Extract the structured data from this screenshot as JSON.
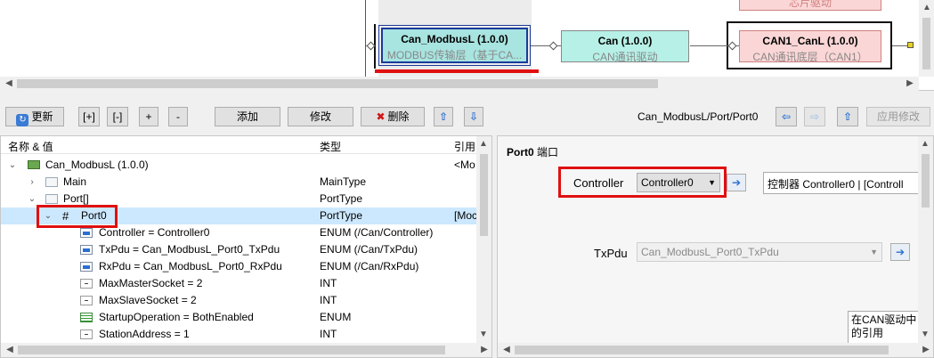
{
  "diagram": {
    "top_node_sub": "芯片驱动",
    "nodes": [
      {
        "title": "Can_ModbusL (1.0.0)",
        "subtitle": "MODBUS传输层（基于CA..."
      },
      {
        "title": "Can (1.0.0)",
        "subtitle": "CAN通讯驱动"
      },
      {
        "title": "CAN1_CanL (1.0.0)",
        "subtitle": "CAN通讯底层（CAN1）"
      }
    ]
  },
  "toolbar": {
    "refresh": "更新",
    "expand": "[+]",
    "collapse": "[-]",
    "plus": "+",
    "minus": "-",
    "add": "添加",
    "edit": "修改",
    "delete": "删除",
    "breadcrumb": "Can_ModbusL/Port/Port0",
    "apply": "应用修改"
  },
  "tree": {
    "headers": {
      "name": "名称 & 值",
      "type": "类型",
      "ref": "引用"
    },
    "rows": [
      {
        "name": "Can_ModbusL (1.0.0)",
        "type": "",
        "ref": "<Mo"
      },
      {
        "name": "Main",
        "type": "MainType",
        "ref": ""
      },
      {
        "name": "Port[]",
        "type": "PortType",
        "ref": ""
      },
      {
        "name": "Port0",
        "type": "PortType",
        "ref": "[Moc"
      },
      {
        "name": "Controller = Controller0",
        "type": "ENUM (/Can/Controller)",
        "ref": ""
      },
      {
        "name": "TxPdu = Can_ModbusL_Port0_TxPdu",
        "type": "ENUM (/Can/TxPdu)",
        "ref": ""
      },
      {
        "name": "RxPdu = Can_ModbusL_Port0_RxPdu",
        "type": "ENUM (/Can/RxPdu)",
        "ref": ""
      },
      {
        "name": "MaxMasterSocket = 2",
        "type": "INT",
        "ref": ""
      },
      {
        "name": "MaxSlaveSocket = 2",
        "type": "INT",
        "ref": ""
      },
      {
        "name": "StartupOperation = BothEnabled",
        "type": "ENUM",
        "ref": ""
      },
      {
        "name": "StationAddress = 1",
        "type": "INT",
        "ref": ""
      }
    ]
  },
  "props": {
    "title": "Port0",
    "title_cn": "端口",
    "controller_label": "Controller",
    "controller_value": "Controller0",
    "controller_desc": "控制器 Controller0 | [Controll",
    "txpdu_label": "TxPdu",
    "txpdu_value": "Can_ModbusL_Port0_TxPdu",
    "note_line1": "在CAN驱动中",
    "note_line2": "的引用"
  }
}
